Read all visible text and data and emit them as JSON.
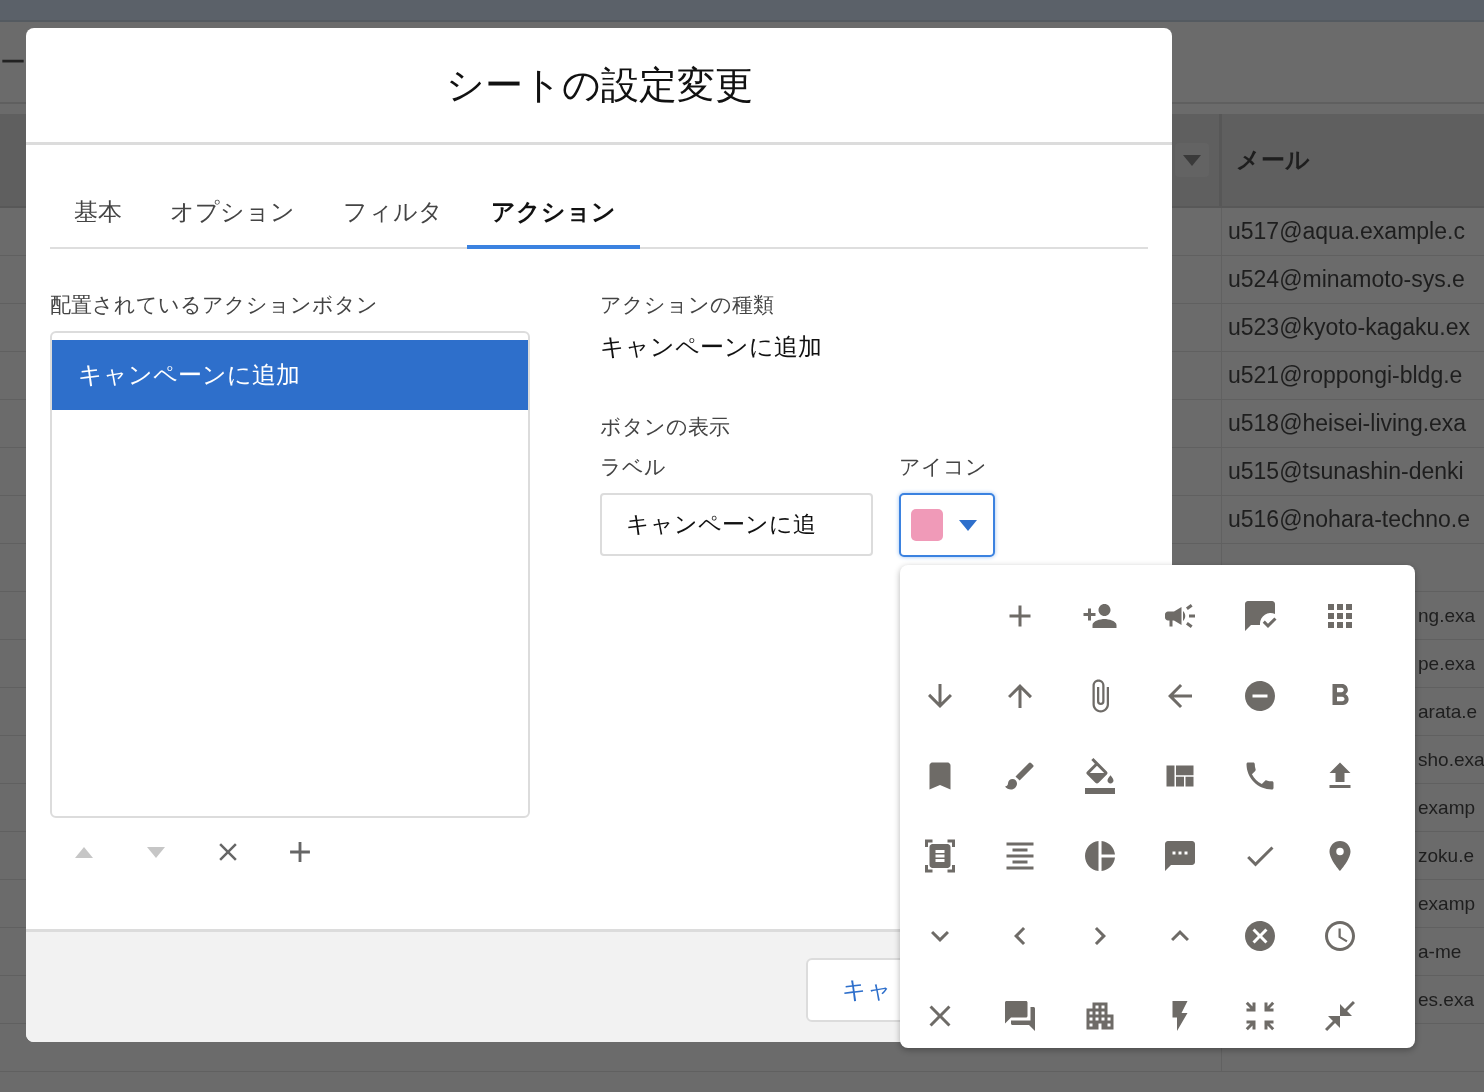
{
  "background": {
    "fragment": "ー",
    "email_header": "メール",
    "emails_above": [
      "u517@aqua.example.c",
      "u524@minamoto-sys.e",
      "u523@kyoto-kagaku.ex",
      "u521@roppongi-bldg.e",
      "u518@heisei-living.exa",
      "u515@tsunashin-denki",
      "u516@nohara-techno.e"
    ],
    "emails_right": [
      "ng.exa",
      "pe.exa",
      "arata.e",
      "sho.exa",
      "examp",
      "zoku.e",
      "examp",
      "a-me",
      "es.exa"
    ]
  },
  "dialog": {
    "title": "シートの設定変更",
    "tabs": [
      {
        "label": "基本",
        "selected": false
      },
      {
        "label": "オプション",
        "selected": false
      },
      {
        "label": "フィルタ",
        "selected": false
      },
      {
        "label": "アクション",
        "selected": true
      }
    ],
    "placed_buttons": {
      "label": "配置されているアクションボタン",
      "items": [
        {
          "label": "キャンペーンに追加",
          "selected": true
        }
      ]
    },
    "list_controls": [
      {
        "kind": "move_up",
        "disabled": true
      },
      {
        "kind": "move_down",
        "disabled": true
      },
      {
        "kind": "remove",
        "disabled": false
      },
      {
        "kind": "add",
        "disabled": false
      }
    ],
    "action_type": {
      "label": "アクションの種類",
      "value": "キャンペーンに追加"
    },
    "display": {
      "heading": "ボタンの表示",
      "label_field": {
        "label": "ラベル",
        "value": "キャンペーンに追"
      },
      "icon_field": {
        "label": "アイコン",
        "expanded": true
      }
    },
    "footer": {
      "buttons": [
        "キャ"
      ]
    }
  }
}
